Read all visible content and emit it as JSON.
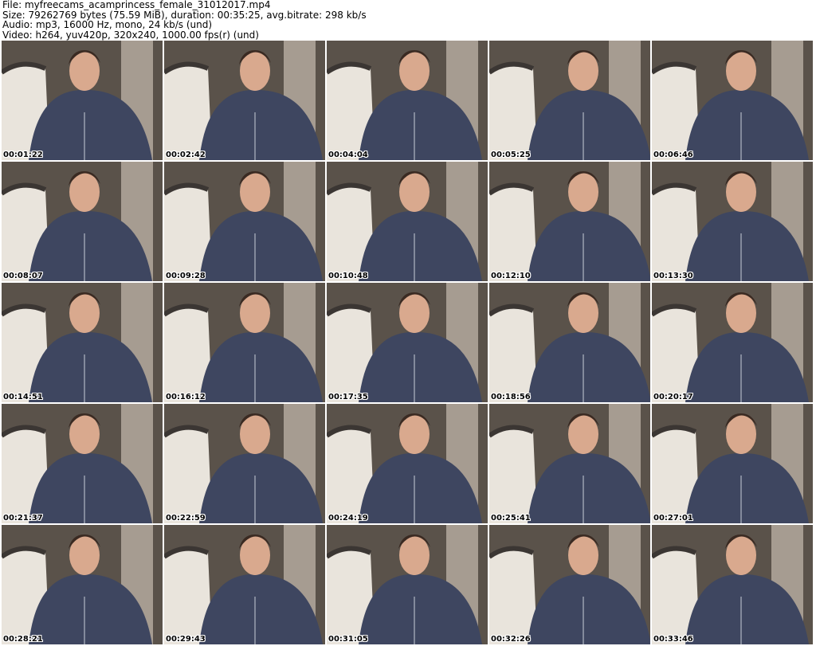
{
  "header": {
    "file": "File: myfreecams_acamprincess_female_31012017.mp4",
    "size": "Size: 79262769 bytes (75.59 MiB), duration: 00:35:25, avg.bitrate: 298 kb/s",
    "audio": "Audio: mp3, 16000 Hz, mono, 24 kb/s (und)",
    "video": "Video: h264, yuv420p, 320x240, 1000.00 fps(r) (und)"
  },
  "thumbnails": [
    {
      "timestamp": "00:01:22"
    },
    {
      "timestamp": "00:02:42"
    },
    {
      "timestamp": "00:04:04"
    },
    {
      "timestamp": "00:05:25"
    },
    {
      "timestamp": "00:06:46"
    },
    {
      "timestamp": "00:08:07"
    },
    {
      "timestamp": "00:09:28"
    },
    {
      "timestamp": "00:10:48"
    },
    {
      "timestamp": "00:12:10"
    },
    {
      "timestamp": "00:13:30"
    },
    {
      "timestamp": "00:14:51"
    },
    {
      "timestamp": "00:16:12"
    },
    {
      "timestamp": "00:17:35"
    },
    {
      "timestamp": "00:18:56"
    },
    {
      "timestamp": "00:20:17"
    },
    {
      "timestamp": "00:21:37"
    },
    {
      "timestamp": "00:22:59"
    },
    {
      "timestamp": "00:24:19"
    },
    {
      "timestamp": "00:25:41"
    },
    {
      "timestamp": "00:27:01"
    },
    {
      "timestamp": "00:28:21"
    },
    {
      "timestamp": "00:29:43"
    },
    {
      "timestamp": "00:31:05"
    },
    {
      "timestamp": "00:32:26"
    },
    {
      "timestamp": "00:33:46"
    }
  ],
  "colors": {
    "wall": "#5a524a",
    "curtain": "#d8cfc2",
    "chair": "#e9e4dc",
    "hoodie": "#3e4660",
    "skin": "#d9a98e",
    "hair": "#3a2a22"
  }
}
